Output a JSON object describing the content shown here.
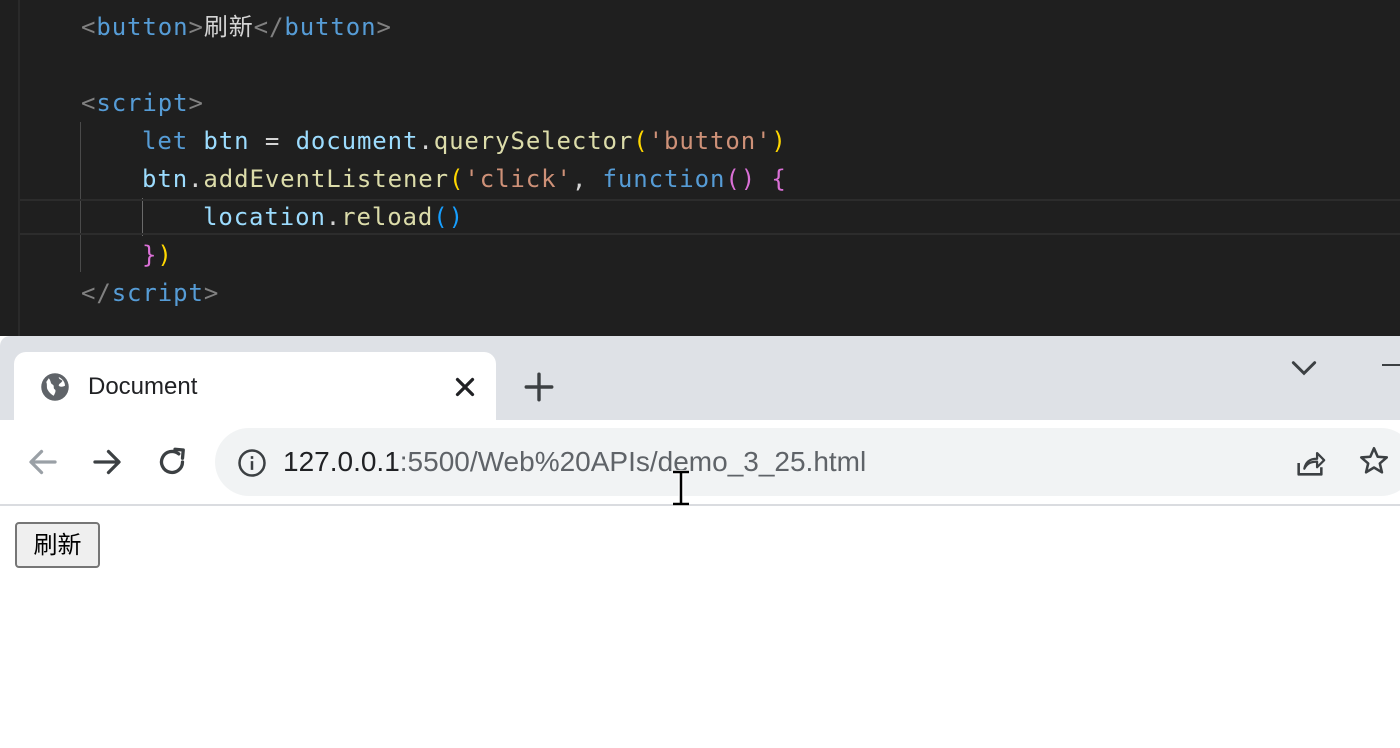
{
  "editor": {
    "lines": [
      {
        "bracket_open": "<",
        "tag": "button",
        "bracket_close": ">",
        "text": "刷新",
        "close_open": "</",
        "close_tag": "button",
        "close_close": ">"
      },
      {
        "bracket_open": "<",
        "tag": "script",
        "bracket_close": ">"
      },
      {
        "kw": "let",
        "var": "btn",
        "op": "=",
        "obj": "document",
        "dot": ".",
        "method": "querySelector",
        "p_open": "(",
        "str": "'button'",
        "p_close": ")"
      },
      {
        "obj": "btn",
        "dot": ".",
        "method": "addEventListener",
        "p_open": "(",
        "str": "'click'",
        "comma": ",",
        "kw": "function",
        "p2": "()",
        "brace": "{"
      },
      {
        "obj": "location",
        "dot": ".",
        "method": "reload",
        "parens": "()"
      },
      {
        "brace": "}",
        "p_close": ")"
      },
      {
        "bracket_open": "</",
        "tag": "script",
        "bracket_close": ">"
      }
    ]
  },
  "browser": {
    "tab": {
      "title": "Document",
      "icon": "globe-icon"
    },
    "toolbar": {
      "back_icon": "back-arrow-icon",
      "forward_icon": "forward-arrow-icon",
      "reload_icon": "reload-icon",
      "url_host": "127.0.0.1",
      "url_rest": ":5500/Web%20APIs/demo_3_25.html"
    },
    "page": {
      "button_label": "刷新"
    }
  },
  "colors": {
    "editor_bg": "#1f1f1f",
    "tabstrip_bg": "#dee1e6",
    "omnibox_bg": "#f1f3f4"
  }
}
